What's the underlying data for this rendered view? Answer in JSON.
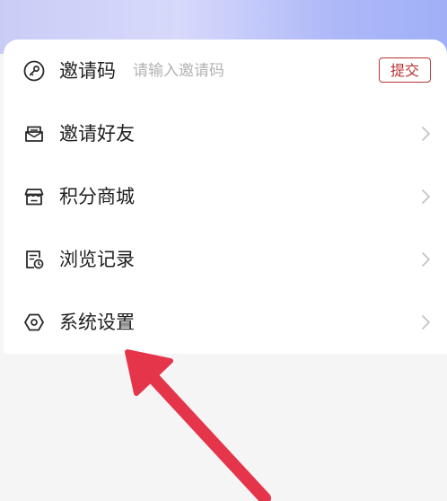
{
  "invite": {
    "label": "邀请码",
    "placeholder": "请输入邀请码",
    "submit_label": "提交"
  },
  "menu": [
    {
      "label": "邀请好友",
      "icon": "mail-icon"
    },
    {
      "label": "积分商城",
      "icon": "store-icon"
    },
    {
      "label": "浏览记录",
      "icon": "history-icon"
    },
    {
      "label": "系统设置",
      "icon": "settings-icon"
    }
  ],
  "colors": {
    "accent": "#b8312f",
    "arrow": "#e5354a",
    "header_gradient": "#aeb8f8"
  }
}
